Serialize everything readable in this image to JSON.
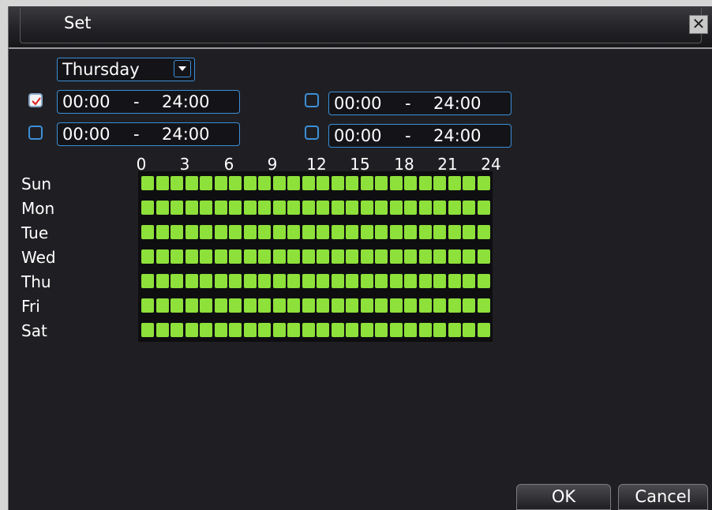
{
  "window": {
    "title": "Set"
  },
  "day_select": {
    "value": "Thursday"
  },
  "periods": [
    {
      "checked": true,
      "start": "00:00",
      "sep": "-",
      "end": "24:00"
    },
    {
      "checked": false,
      "start": "00:00",
      "sep": "-",
      "end": "24:00"
    },
    {
      "checked": false,
      "start": "00:00",
      "sep": "-",
      "end": "24:00"
    },
    {
      "checked": false,
      "start": "00:00",
      "sep": "-",
      "end": "24:00"
    }
  ],
  "hour_labels": [
    "0",
    "3",
    "6",
    "9",
    "12",
    "15",
    "18",
    "21",
    "24"
  ],
  "days": [
    "Sun",
    "Mon",
    "Tue",
    "Wed",
    "Thu",
    "Fri",
    "Sat"
  ],
  "schedule": {
    "segments_per_day": 24,
    "active_color": "#8ee03a",
    "active_fraction": 1.0
  },
  "buttons": {
    "ok": "OK",
    "cancel": "Cancel"
  },
  "colors": {
    "accent": "#3c8fd8",
    "check_mark": "#e02020",
    "background": "#1f1f23"
  }
}
